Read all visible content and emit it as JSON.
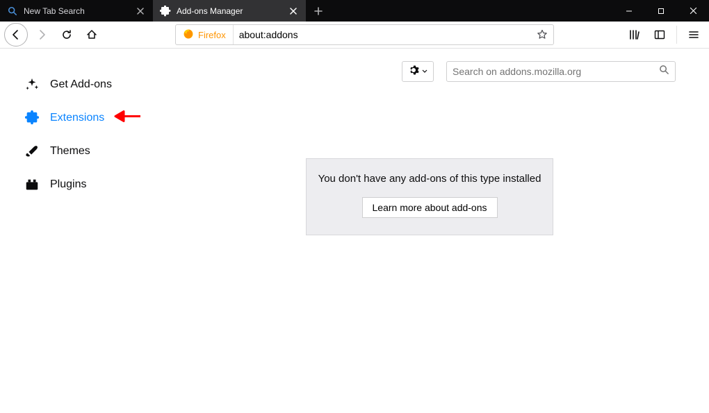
{
  "tabs": [
    {
      "label": "New Tab Search"
    },
    {
      "label": "Add-ons Manager"
    }
  ],
  "urlbar": {
    "identity_label": "Firefox",
    "url": "about:addons"
  },
  "sidebar": {
    "items": [
      {
        "label": "Get Add-ons"
      },
      {
        "label": "Extensions"
      },
      {
        "label": "Themes"
      },
      {
        "label": "Plugins"
      }
    ]
  },
  "search": {
    "placeholder": "Search on addons.mozilla.org"
  },
  "empty": {
    "message": "You don't have any add-ons of this type installed",
    "learn_label": "Learn more about add-ons"
  }
}
